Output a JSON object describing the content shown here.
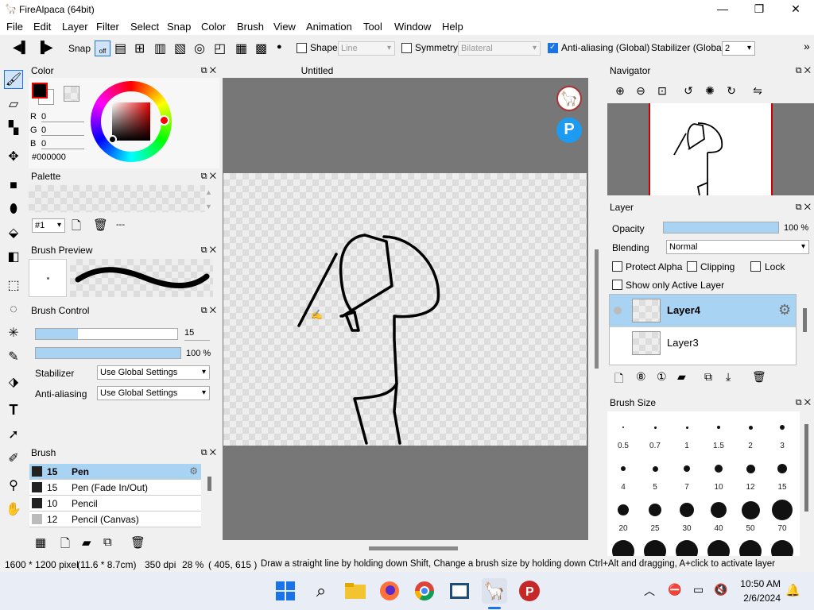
{
  "window": {
    "title": "FireAlpaca (64bit)"
  },
  "menu": [
    "File",
    "Edit",
    "Layer",
    "Filter",
    "Select",
    "Snap",
    "Color",
    "Brush",
    "View",
    "Animation",
    "Tool",
    "Window",
    "Help"
  ],
  "toolbar": {
    "snap_label": "Snap",
    "snap_off": "off",
    "shape_label": "Shape",
    "shape_value": "Line",
    "symmetry_label": "Symmetry",
    "symmetry_value": "Bilateral",
    "antialias_label": "Anti-aliasing (Global)",
    "stabilizer_label": "Stabilizer (Global)",
    "stabilizer_value": "2",
    "overflow": "»"
  },
  "color_panel": {
    "title": "Color",
    "r_label": "R",
    "g_label": "G",
    "b_label": "B",
    "r": "0",
    "g": "0",
    "b": "0",
    "hex": "#000000"
  },
  "palette_panel": {
    "title": "Palette",
    "index": "#1",
    "dash": "---"
  },
  "brush_preview_panel": {
    "title": "Brush Preview"
  },
  "brush_control": {
    "title": "Brush Control",
    "size": "15",
    "opacity": "100 %",
    "stabilizer_label": "Stabilizer",
    "stabilizer_value": "Use Global Settings",
    "antialias_label": "Anti-aliasing",
    "antialias_value": "Use Global Settings"
  },
  "brush_panel": {
    "title": "Brush",
    "items": [
      {
        "size": "15",
        "name": "Pen"
      },
      {
        "size": "15",
        "name": "Pen (Fade In/Out)"
      },
      {
        "size": "10",
        "name": "Pencil"
      },
      {
        "size": "12",
        "name": "Pencil (Canvas)"
      }
    ]
  },
  "canvas": {
    "tab": "Untitled"
  },
  "navigator": {
    "title": "Navigator"
  },
  "layer_panel": {
    "title": "Layer",
    "opacity_label": "Opacity",
    "opacity_value": "100 %",
    "blending_label": "Blending",
    "blending_value": "Normal",
    "protect_alpha": "Protect Alpha",
    "clipping": "Clipping",
    "lock": "Lock",
    "show_only_active": "Show only Active Layer",
    "layers": [
      "Layer4",
      "Layer3"
    ]
  },
  "brush_size_panel": {
    "title": "Brush Size",
    "sizes": [
      "0.5",
      "0.7",
      "1",
      "1.5",
      "2",
      "3",
      "4",
      "5",
      "7",
      "10",
      "12",
      "15",
      "20",
      "25",
      "30",
      "40",
      "50",
      "70"
    ]
  },
  "status": {
    "dims": "1600 * 1200 pixel",
    "cm": "(11.6 * 8.7cm)",
    "dpi": "350 dpi",
    "zoom": "28 %",
    "coords": "( 405, 615 )",
    "hint": "Draw a straight line by holding down Shift, Change a brush size by holding down Ctrl+Alt and dragging, A+click to activate layer"
  },
  "taskbar": {
    "time": "10:50 AM",
    "date": "2/6/2024"
  }
}
